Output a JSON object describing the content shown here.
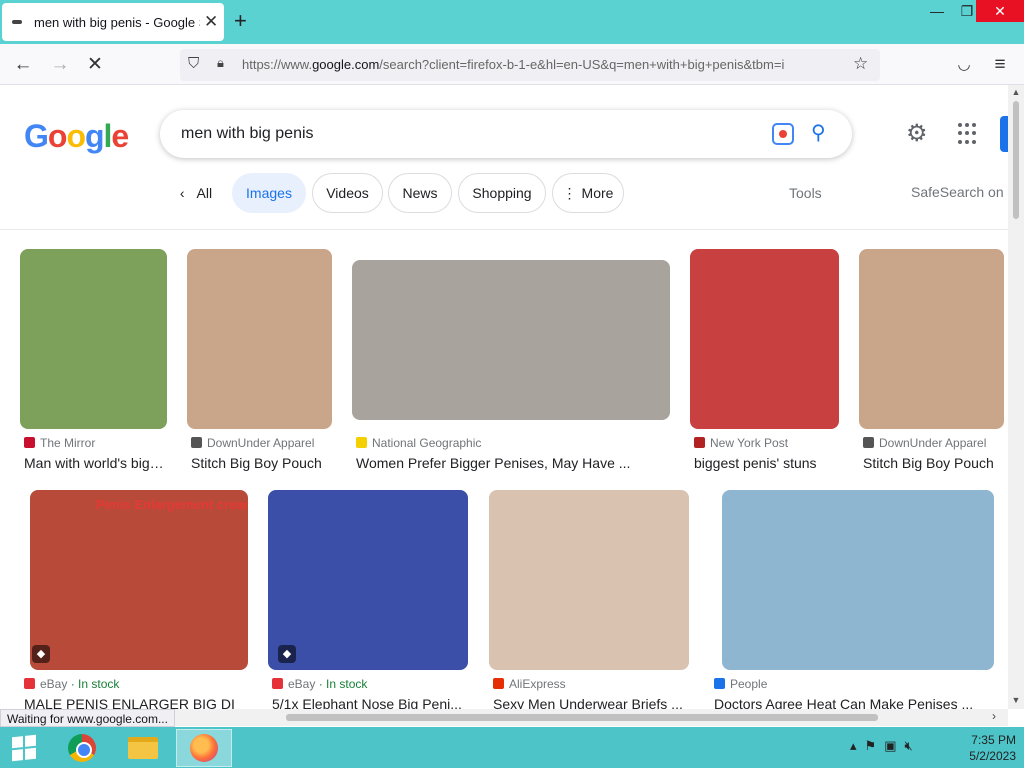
{
  "browser": {
    "tab_title": "men with big penis - Google Search",
    "tab_close": "✕",
    "new_tab": "+",
    "url_prefix": "https://www.",
    "url_domain": "google.com",
    "url_rest": "/search?client=firefox-b-1-e&hl=en-US&q=men+with+big+penis&tbm=i",
    "window_buttons": {
      "minimize": "—",
      "maximize": "❐",
      "close": "✕"
    },
    "status_text": "Waiting for www.google.com..."
  },
  "google": {
    "search_query": "men with big penis",
    "chips": [
      {
        "label": "All"
      },
      {
        "label": "Images"
      },
      {
        "label": "Videos"
      },
      {
        "label": "News"
      },
      {
        "label": "Shopping"
      },
      {
        "label": "More"
      }
    ],
    "tools_label": "Tools",
    "safesearch_label": "SafeSearch on"
  },
  "results_row1": [
    {
      "source": "The Mirror",
      "title": "Man with world's biggest penis",
      "icon_color": "#c8102e",
      "thumb_color": "#7da05a"
    },
    {
      "source": "DownUnder Apparel",
      "title": "Stitch Big Boy Pouch",
      "icon_color": "#555555",
      "thumb_color": "#c9a58a"
    },
    {
      "source": "National Geographic",
      "title": "Women Prefer Bigger Penises, May Have ...",
      "icon_color": "#f5d000",
      "thumb_color": "#a8a39d"
    },
    {
      "source": "New York Post",
      "title": "biggest penis' stuns",
      "icon_color": "#b22222",
      "thumb_color": "#c94040"
    },
    {
      "source": "DownUnder Apparel",
      "title": "Stitch Big Boy Pouch",
      "icon_color": "#555555",
      "thumb_color": "#c9a58a"
    }
  ],
  "results_row2": [
    {
      "source": "eBay",
      "stock": " · In stock",
      "title": "MALE PENIS ENLARGER BIG DI",
      "icon_color": "#e53238",
      "thumb_color": "#b84a3a",
      "overlay_text": "Penis Enlargement cream"
    },
    {
      "source": "eBay",
      "stock": " · In stock",
      "title": "5/1x Elephant Nose Big Peni...",
      "icon_color": "#e53238",
      "thumb_color": "#3b4ea8",
      "overlay_text": ""
    },
    {
      "source": "AliExpress",
      "stock": "",
      "title": "Sexy Men Underwear Briefs ...",
      "icon_color": "#e62e04",
      "thumb_color": "#d9c2b0",
      "overlay_text": ""
    },
    {
      "source": "People",
      "stock": "",
      "title": "Doctors Agree Heat Can Make Penises ...",
      "icon_color": "#1a73e8",
      "thumb_color": "#8fb6d0",
      "overlay_text": ""
    }
  ],
  "taskbar": {
    "time": "7:35 PM",
    "date": "5/2/2023"
  }
}
